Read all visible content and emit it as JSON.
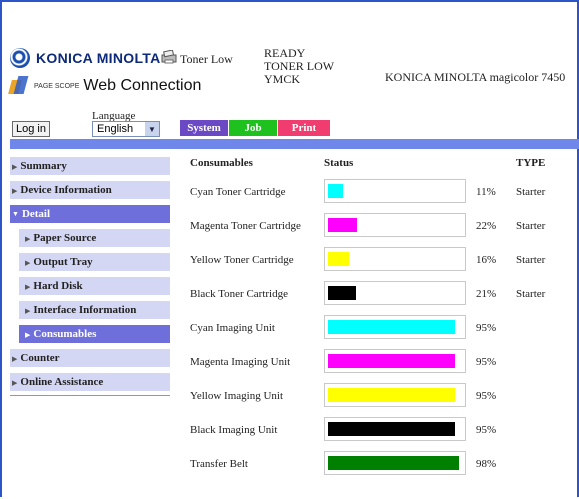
{
  "header": {
    "brand": "KONICA MINOLTA",
    "pagescope": "PAGE SCOPE",
    "product": "Web Connection",
    "alert": "Toner Low",
    "status_lines": [
      "READY",
      "TONER LOW",
      "YMCK"
    ],
    "model": "KONICA MINOLTA magicolor 7450"
  },
  "controls": {
    "language_label": "Language",
    "login_label": "Log in",
    "language_value": "English"
  },
  "tabs": [
    "System",
    "Job",
    "Print"
  ],
  "sidebar": [
    {
      "label": "Summary",
      "level": 0,
      "active": false
    },
    {
      "label": "Device Information",
      "level": 0,
      "active": false
    },
    {
      "label": "Detail",
      "level": 0,
      "active": true,
      "expanded": true
    },
    {
      "label": "Paper Source",
      "level": 1,
      "active": false
    },
    {
      "label": "Output Tray",
      "level": 1,
      "active": false
    },
    {
      "label": "Hard Disk",
      "level": 1,
      "active": false
    },
    {
      "label": "Interface Information",
      "level": 1,
      "active": false
    },
    {
      "label": "Consumables",
      "level": 1,
      "active": true
    },
    {
      "label": "Counter",
      "level": 0,
      "active": false
    },
    {
      "label": "Online Assistance",
      "level": 0,
      "active": false
    }
  ],
  "consumables": {
    "columns": {
      "name": "Consumables",
      "status": "Status",
      "type": "TYPE"
    },
    "rows": [
      {
        "name": "Cyan Toner Cartridge",
        "percent": "11%",
        "level": 0.11,
        "color": "#00ffff",
        "type": "Starter"
      },
      {
        "name": "Magenta Toner Cartridge",
        "percent": "22%",
        "level": 0.22,
        "color": "#ff00ff",
        "type": "Starter"
      },
      {
        "name": "Yellow Toner Cartridge",
        "percent": "16%",
        "level": 0.16,
        "color": "#ffff00",
        "type": "Starter"
      },
      {
        "name": "Black Toner Cartridge",
        "percent": "21%",
        "level": 0.21,
        "color": "#000000",
        "type": "Starter"
      },
      {
        "name": "Cyan Imaging Unit",
        "percent": "95%",
        "level": 0.95,
        "color": "#00ffff",
        "type": ""
      },
      {
        "name": "Magenta Imaging Unit",
        "percent": "95%",
        "level": 0.95,
        "color": "#ff00ff",
        "type": ""
      },
      {
        "name": "Yellow Imaging Unit",
        "percent": "95%",
        "level": 0.95,
        "color": "#ffff00",
        "type": ""
      },
      {
        "name": "Black Imaging Unit",
        "percent": "95%",
        "level": 0.95,
        "color": "#000000",
        "type": ""
      },
      {
        "name": "Transfer Belt",
        "percent": "98%",
        "level": 0.98,
        "color": "#008000",
        "type": ""
      }
    ]
  }
}
